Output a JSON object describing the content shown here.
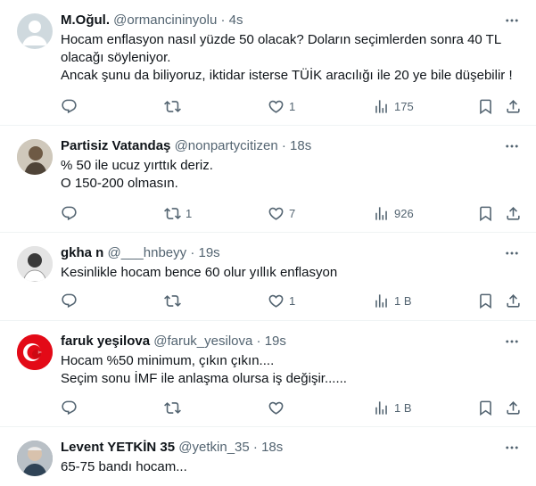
{
  "tweets": [
    {
      "name": "M.Oğul.",
      "handle": "@ormancininyolu",
      "sep": "·",
      "time": "4s",
      "text": "Hocam enflasyon nasıl yüzde 50 olacak? Doların seçimlerden sonra 40 TL olacağı söyleniyor.\nAncak şunu da biliyoruz, iktidar isterse TÜİK aracılığı ile 20 ye bile düşebilir !",
      "replies": "",
      "retweets": "",
      "likes": "1",
      "views": "175",
      "avatar_icon": "default-avatar-icon"
    },
    {
      "name": "Partisiz Vatandaş",
      "handle": "@nonpartycitizen",
      "sep": "·",
      "time": "18s",
      "text": "% 50 ile ucuz yırttık deriz.\nO  150-200 olmasın.",
      "replies": "",
      "retweets": "1",
      "likes": "7",
      "views": "926",
      "avatar_icon": "photo-avatar"
    },
    {
      "name": "gkha n",
      "handle": "@___hnbeyy",
      "sep": "·",
      "time": "19s",
      "text": "Kesinlikle  hocam bence 60 olur yıllık enflasyon",
      "replies": "",
      "retweets": "",
      "likes": "1",
      "views": "1 B",
      "avatar_icon": "photo-avatar"
    },
    {
      "name": "faruk yeşilova",
      "handle": "@faruk_yesilova",
      "sep": "·",
      "time": "19s",
      "text": "Hocam %50 minimum, çıkın çıkın....\nSeçim sonu İMF ile anlaşma olursa iş değişir......",
      "replies": "",
      "retweets": "",
      "likes": "",
      "views": "1 B",
      "avatar_icon": "flag-avatar"
    },
    {
      "name": "Levent YETKİN 35",
      "handle": "@yetkin_35",
      "sep": "·",
      "time": "18s",
      "text": "65-75 bandı hocam...",
      "replies": "",
      "retweets": "",
      "likes": "",
      "views": "",
      "avatar_icon": "photo-avatar"
    }
  ],
  "colors": {
    "text": "#0f1419",
    "muted": "#536471",
    "divider": "#eff3f4",
    "accent": "#1d9bf0"
  }
}
